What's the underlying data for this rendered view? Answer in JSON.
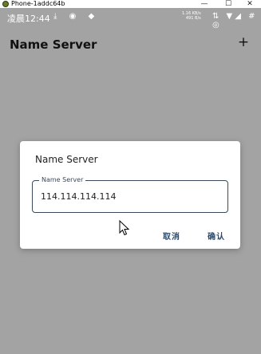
{
  "window": {
    "title": "Phone-1addc64b",
    "controls": {
      "minimize": "—",
      "maximize": "☐",
      "close": "✕"
    }
  },
  "statusbar": {
    "time": "凌晨12:44",
    "left_icons": "⤓ ◉ ◆",
    "speed_up": "1.16 KB/s",
    "speed_down": "491 B/s",
    "right_icons": "⇅ ▼◢ # ◎"
  },
  "appbar": {
    "title": "Name Server",
    "add_label": "+"
  },
  "dialog": {
    "title": "Name Server",
    "field_label": "Name Server",
    "field_value": "114.114.114.114",
    "cancel_label": "取消",
    "ok_label": "确认"
  },
  "colors": {
    "scrim": "#a3a3a3",
    "accent": "#2c4a6e",
    "field_border": "#3a4a5c"
  }
}
